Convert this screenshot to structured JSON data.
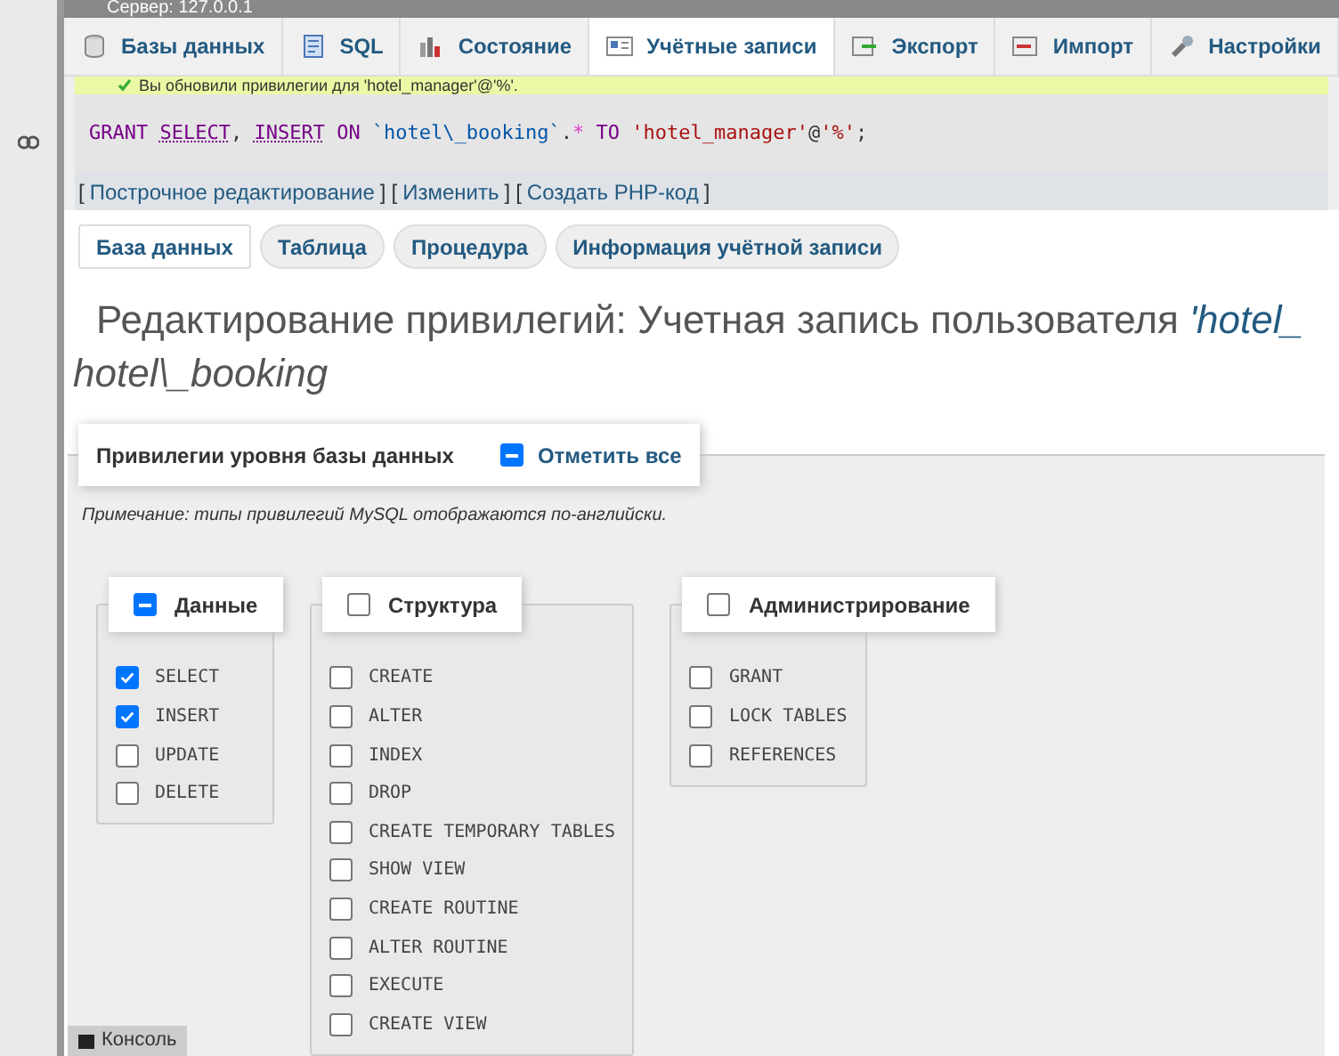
{
  "server_label": "Сервер: 127.0.0.1",
  "tabs": [
    {
      "label": "Базы данных",
      "selected": false
    },
    {
      "label": "SQL",
      "selected": false
    },
    {
      "label": "Состояние",
      "selected": false
    },
    {
      "label": "Учётные записи",
      "selected": true
    },
    {
      "label": "Экспорт",
      "selected": false
    },
    {
      "label": "Импорт",
      "selected": false
    },
    {
      "label": "Настройки",
      "selected": false
    }
  ],
  "message": "Вы обновили привилегии для 'hotel_manager'@'%'.",
  "sql": [
    {
      "tokens": [
        {
          "kind": "kw",
          "text": "GRANT"
        }
      ]
    },
    {
      "tokens": [
        {
          "kind": "fn",
          "text": "SELECT"
        },
        {
          "kind": "plain",
          "text": ","
        }
      ]
    },
    {
      "tokens": [
        {
          "kind": "fn",
          "text": "INSERT"
        }
      ]
    },
    {
      "tokens": [
        {
          "kind": "kw",
          "text": "ON"
        }
      ]
    },
    {
      "tokens": [
        {
          "kind": "ident",
          "text": "`hotel\\_booking`"
        },
        {
          "kind": "plain",
          "text": "."
        },
        {
          "kind": "op",
          "text": "*"
        }
      ]
    },
    {
      "tokens": [
        {
          "kind": "kw",
          "text": "TO"
        }
      ]
    },
    {
      "tokens": [
        {
          "kind": "str",
          "text": "'hotel_manager'"
        },
        {
          "kind": "plain",
          "text": "@"
        },
        {
          "kind": "str",
          "text": "'%'"
        },
        {
          "kind": "plain",
          "text": ";"
        }
      ]
    }
  ],
  "actions": [
    {
      "open": "[",
      "label": "Построчное редактирование",
      "close": "]"
    },
    {
      "open": "[",
      "label": "Изменить",
      "close": "]"
    },
    {
      "open": "[",
      "label": "Создать PHP-код",
      "close": "]"
    }
  ],
  "subtabs": [
    {
      "label": "База данных",
      "selected": true
    },
    {
      "label": "Таблица",
      "selected": false
    },
    {
      "label": "Процедура",
      "selected": false
    },
    {
      "label": "Информация учётной записи",
      "selected": false
    }
  ],
  "heading": {
    "text": "Редактирование привилегий: Учетная запись пользователя",
    "user": "'hotel_",
    "db": "hotel\\_booking"
  },
  "legend": {
    "title": "Привилегии уровня базы данных",
    "select_all": "Отметить все",
    "indeterminate": true
  },
  "note": "Примечание: типы привилегий MySQL отображаются по-английски.",
  "groups": [
    {
      "title": "Данные",
      "indeterminate": true,
      "items": [
        {
          "label": "SELECT",
          "checked": true
        },
        {
          "label": "INSERT",
          "checked": true
        },
        {
          "label": "UPDATE",
          "checked": false
        },
        {
          "label": "DELETE",
          "checked": false
        }
      ]
    },
    {
      "title": "Структура",
      "checked": false,
      "indeterminate": false,
      "items": [
        {
          "label": "CREATE",
          "checked": false
        },
        {
          "label": "ALTER",
          "checked": false
        },
        {
          "label": "INDEX",
          "checked": false
        },
        {
          "label": "DROP",
          "checked": false
        },
        {
          "label": "CREATE TEMPORARY TABLES",
          "checked": false
        },
        {
          "label": "SHOW VIEW",
          "checked": false
        },
        {
          "label": "CREATE ROUTINE",
          "checked": false
        },
        {
          "label": "ALTER ROUTINE",
          "checked": false
        },
        {
          "label": "EXECUTE",
          "checked": false
        },
        {
          "label": "CREATE VIEW",
          "checked": false
        }
      ]
    },
    {
      "title": "Администрирование",
      "checked": false,
      "indeterminate": false,
      "items": [
        {
          "label": "GRANT",
          "checked": false
        },
        {
          "label": "LOCK TABLES",
          "checked": false
        },
        {
          "label": "REFERENCES",
          "checked": false
        }
      ]
    }
  ],
  "console": "Консоль"
}
